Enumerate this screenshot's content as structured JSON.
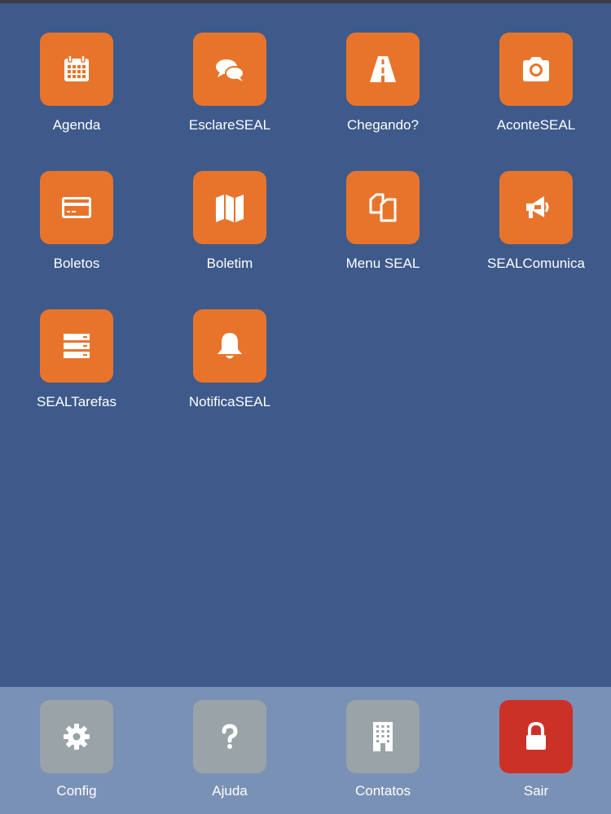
{
  "apps": [
    {
      "label": "Agenda",
      "icon": "calendar-icon"
    },
    {
      "label": "EsclareSEAL",
      "icon": "chat-bubbles-icon"
    },
    {
      "label": "Chegando?",
      "icon": "road-icon"
    },
    {
      "label": "AconteSEAL",
      "icon": "camera-icon"
    },
    {
      "label": "Boletos",
      "icon": "credit-card-icon"
    },
    {
      "label": "Boletim",
      "icon": "map-icon"
    },
    {
      "label": "Menu SEAL",
      "icon": "copy-files-icon"
    },
    {
      "label": "SEALComunica",
      "icon": "megaphone-icon"
    },
    {
      "label": "SEALTarefas",
      "icon": "tasks-list-icon"
    },
    {
      "label": "NotificaSEAL",
      "icon": "bell-icon"
    }
  ],
  "bottom_bar": [
    {
      "label": "Config",
      "icon": "gear-icon"
    },
    {
      "label": "Ajuda",
      "icon": "question-icon"
    },
    {
      "label": "Contatos",
      "icon": "building-icon"
    },
    {
      "label": "Sair",
      "icon": "lock-icon"
    }
  ],
  "colors": {
    "background": "#3d5a8a",
    "tile": "#e8742b",
    "bottom_bar": "#7a91b6",
    "bottom_tile": "#99a3a8",
    "logout_tile": "#cc3128"
  }
}
